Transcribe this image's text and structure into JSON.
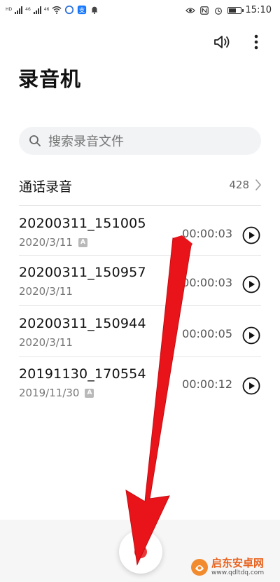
{
  "status_bar": {
    "left_labels": [
      "HD",
      "46",
      "46"
    ],
    "time": "15:10",
    "battery_level": 0.7
  },
  "header": {
    "title": "录音机",
    "speaker_icon": "speaker-icon",
    "more_icon": "more-vertical-icon"
  },
  "search": {
    "placeholder": "搜索录音文件",
    "icon": "search-icon"
  },
  "call_recordings": {
    "label": "通话录音",
    "count": "428"
  },
  "recordings": [
    {
      "name": "20200311_151005",
      "date": "2020/3/11",
      "badge": "A",
      "duration": "00:00:03"
    },
    {
      "name": "20200311_150957",
      "date": "2020/3/11",
      "badge": "",
      "duration": "00:00:03"
    },
    {
      "name": "20200311_150944",
      "date": "2020/3/11",
      "badge": "",
      "duration": "00:00:05"
    },
    {
      "name": "20191130_170554",
      "date": "2019/11/30",
      "badge": "A",
      "duration": "00:00:12"
    }
  ],
  "record_button": {
    "icon": "record-dot-icon"
  },
  "colors": {
    "record": "#e83a3a",
    "arrow": "#e8141a",
    "watermark": "#e8621e"
  },
  "watermark": {
    "title": "启东安卓网",
    "url": "www.qdltdq.com"
  }
}
